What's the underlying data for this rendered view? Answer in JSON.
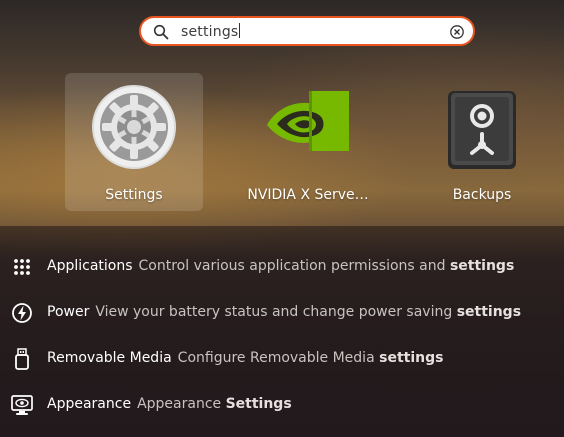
{
  "search": {
    "query": "settings",
    "icon": "search-icon",
    "clear_icon": "clear-icon"
  },
  "apps": [
    {
      "label": "Settings",
      "icon": "settings-gear-icon",
      "selected": true
    },
    {
      "label": "NVIDIA X Serve…",
      "icon": "nvidia-icon",
      "selected": false
    },
    {
      "label": "Backups",
      "icon": "backups-safe-icon",
      "selected": false
    }
  ],
  "results": [
    {
      "name": "Applications",
      "desc": "Control various application permissions and",
      "match": "settings",
      "icon": "app-grid-icon"
    },
    {
      "name": "Power",
      "desc": "View your battery status and change power saving",
      "match": "settings",
      "icon": "power-icon"
    },
    {
      "name": "Removable Media",
      "desc": "Configure Removable Media",
      "match": "settings",
      "icon": "usb-drive-icon"
    },
    {
      "name": "Appearance",
      "desc": "Appearance",
      "match": "Settings",
      "icon": "appearance-icon"
    }
  ],
  "colors": {
    "accent": "#e95420",
    "nvidia_green": "#76b900"
  }
}
